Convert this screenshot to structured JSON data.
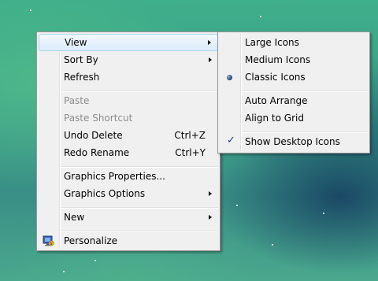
{
  "context_menu": {
    "items": [
      {
        "label": "View"
      },
      {
        "label": "Sort By"
      },
      {
        "label": "Refresh"
      },
      {
        "label": "Paste"
      },
      {
        "label": "Paste Shortcut"
      },
      {
        "label": "Undo Delete",
        "shortcut": "Ctrl+Z"
      },
      {
        "label": "Redo Rename",
        "shortcut": "Ctrl+Y"
      },
      {
        "label": "Graphics Properties..."
      },
      {
        "label": "Graphics Options"
      },
      {
        "label": "New"
      },
      {
        "label": "Personalize",
        "icon": "personalize-icon"
      }
    ]
  },
  "view_submenu": {
    "items": [
      {
        "label": "Large Icons"
      },
      {
        "label": "Medium Icons"
      },
      {
        "label": "Classic Icons",
        "selected": true
      },
      {
        "label": "Auto Arrange"
      },
      {
        "label": "Align to Grid"
      },
      {
        "label": "Show Desktop Icons",
        "checked": true
      }
    ]
  },
  "colors": {
    "menu_bg": "#f0f0f0",
    "highlight_border": "#a8d8eb",
    "disabled_text": "#8d8d8d"
  }
}
